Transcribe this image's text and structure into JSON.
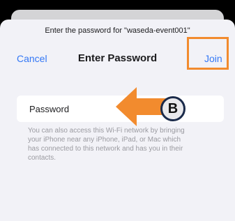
{
  "dialog": {
    "prompt": "Enter the password for \"waseda-event001\"",
    "title": "Enter Password",
    "cancel_label": "Cancel",
    "join_label": "Join"
  },
  "password_field": {
    "placeholder": "Password"
  },
  "help_text": [
    "You can also access this Wi-Fi network by bringing",
    "your iPhone near any iPhone, iPad, or Mac which",
    "has connected to this network and has you in their",
    "contacts."
  ],
  "annotation": {
    "badge_label": "B",
    "arrow_color": "#f28b2e",
    "highlight_color": "#f28b2e"
  },
  "colors": {
    "accent": "#3478f6",
    "sheet_background": "#f2f2f7"
  }
}
